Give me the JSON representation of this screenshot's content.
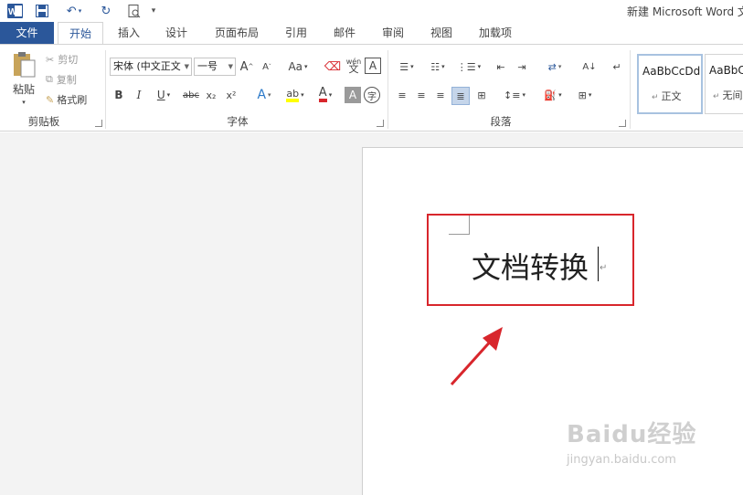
{
  "app": {
    "title": "新建 Microsoft Word 文"
  },
  "tabs": {
    "file": "文件",
    "home": "开始",
    "insert": "插入",
    "design": "设计",
    "layout": "页面布局",
    "references": "引用",
    "mailings": "邮件",
    "review": "审阅",
    "view": "视图",
    "addins": "加载项"
  },
  "clipboard": {
    "paste": "粘贴",
    "cut": "剪切",
    "copy": "复制",
    "format_painter": "格式刷",
    "group": "剪贴板"
  },
  "font": {
    "name": "宋体 (中文正文",
    "size": "一号",
    "group": "字体",
    "aa_label": "Aa",
    "bold": "B",
    "italic": "I",
    "underline": "U",
    "strike": "abc",
    "subscript": "x₂",
    "superscript": "x²",
    "effect": "A",
    "highlight": "ab",
    "color": "A",
    "shade": "A",
    "enclose": "字",
    "phonetic": "wén",
    "border": "A",
    "grow": "A",
    "shrink": "A"
  },
  "paragraph": {
    "group": "段落"
  },
  "styles": {
    "normal_preview": "AaBbCcDd",
    "normal_label": "正文",
    "nospacing_preview": "AaBbC",
    "nospacing_label": "无间"
  },
  "document": {
    "text": "文档转换"
  },
  "watermark": {
    "brand": "Baidu经验",
    "url": "jingyan.baidu.com"
  },
  "colors": {
    "accent": "#2b579a",
    "annotation": "#d8262c"
  }
}
